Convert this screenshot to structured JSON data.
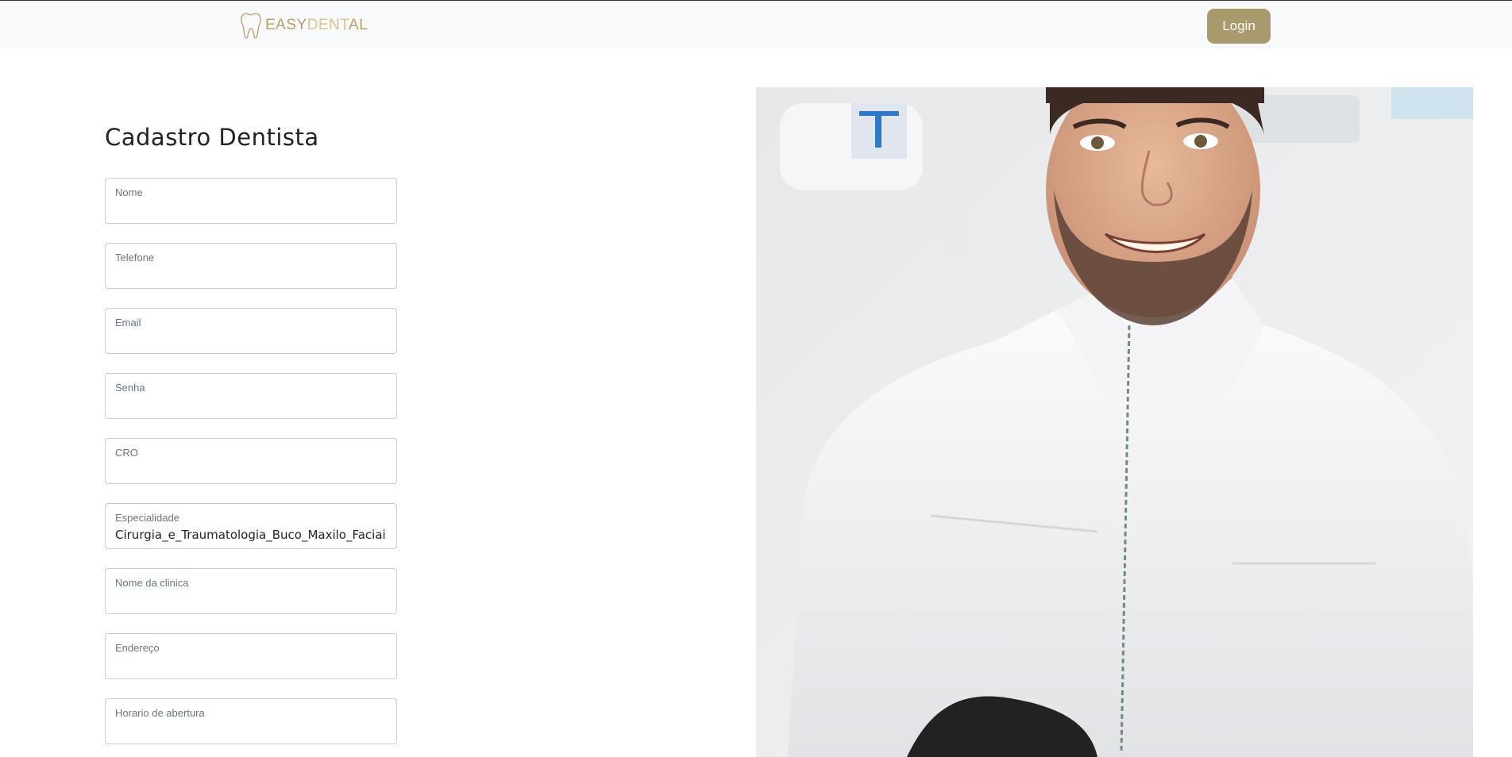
{
  "navbar": {
    "brand_part1": "EASY",
    "brand_part2": "DENT",
    "brand_part3": "AL",
    "login_label": "Login"
  },
  "page": {
    "title": "Cadastro Dentista"
  },
  "form": {
    "fields": [
      {
        "label": "Nome",
        "value": ""
      },
      {
        "label": "Telefone",
        "value": ""
      },
      {
        "label": "Email",
        "value": ""
      },
      {
        "label": "Senha",
        "value": ""
      },
      {
        "label": "CRO",
        "value": ""
      },
      {
        "label": "Especialidade",
        "value": "Cirurgia_e_Traumatologia_Buco_Maxilo_Faciais"
      },
      {
        "label": "Nome da clinica",
        "value": ""
      },
      {
        "label": "Endereço",
        "value": ""
      },
      {
        "label": "Horario de abertura",
        "value": ""
      }
    ]
  },
  "colors": {
    "accent": "#a99a6e",
    "brand_gold": "#b8a06a",
    "navbar_bg": "#f8f9fa"
  },
  "icons": {
    "brand": "tooth-icon"
  }
}
